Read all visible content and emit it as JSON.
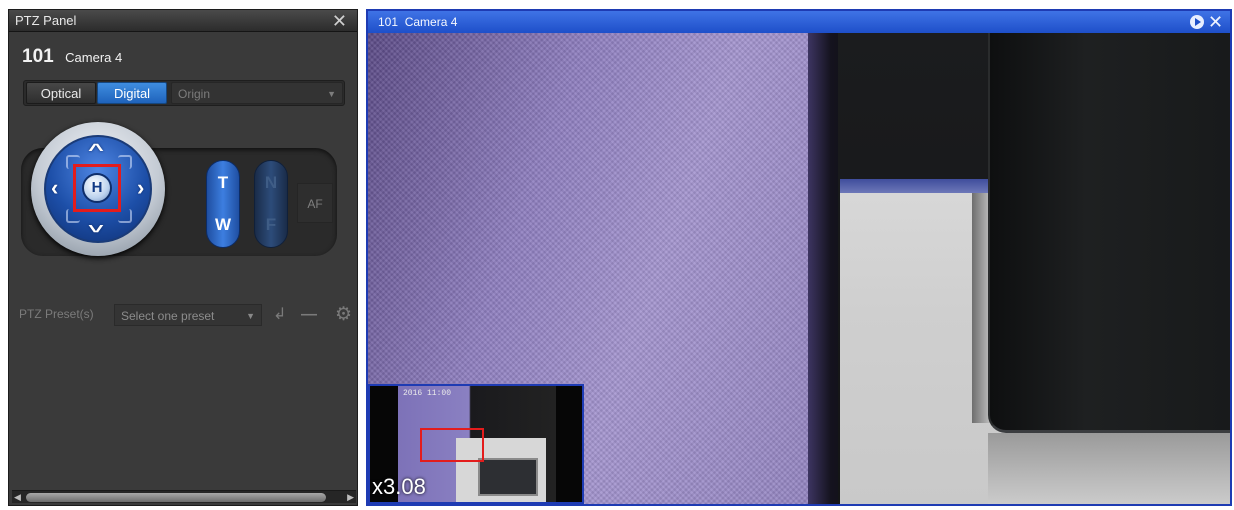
{
  "ptz_panel": {
    "title": "PTZ Panel",
    "close_glyph": "✕",
    "camera_id": "101",
    "camera_name": "Camera 4",
    "zoom_modes": {
      "optical": "Optical",
      "digital": "Digital",
      "selected": "Digital"
    },
    "origin_select": "Origin",
    "home_label": "H",
    "zoom_tele_label": "T",
    "zoom_wide_label": "W",
    "focus_near_label": "N",
    "focus_far_label": "F",
    "af_label": "AF",
    "preset_label": "PTZ Preset(s)",
    "preset_select": "Select one preset",
    "icons": [
      "up-arrow-icon",
      "down-arrow-icon",
      "left-arrow-icon",
      "right-arrow-icon",
      "home-icon",
      "call-preset-icon",
      "remove-preset-icon",
      "gear-icon",
      "close-icon"
    ]
  },
  "video_pane": {
    "title": "101  Camera 4",
    "close_glyph": "✕",
    "minimap_timestamp": "2016 11:00",
    "digital_zoom": "x3.08",
    "colors": {
      "title_bar": "#1e4fc9",
      "roi_box": "#e31c1c",
      "pane_border": "#1e3bb3"
    }
  }
}
